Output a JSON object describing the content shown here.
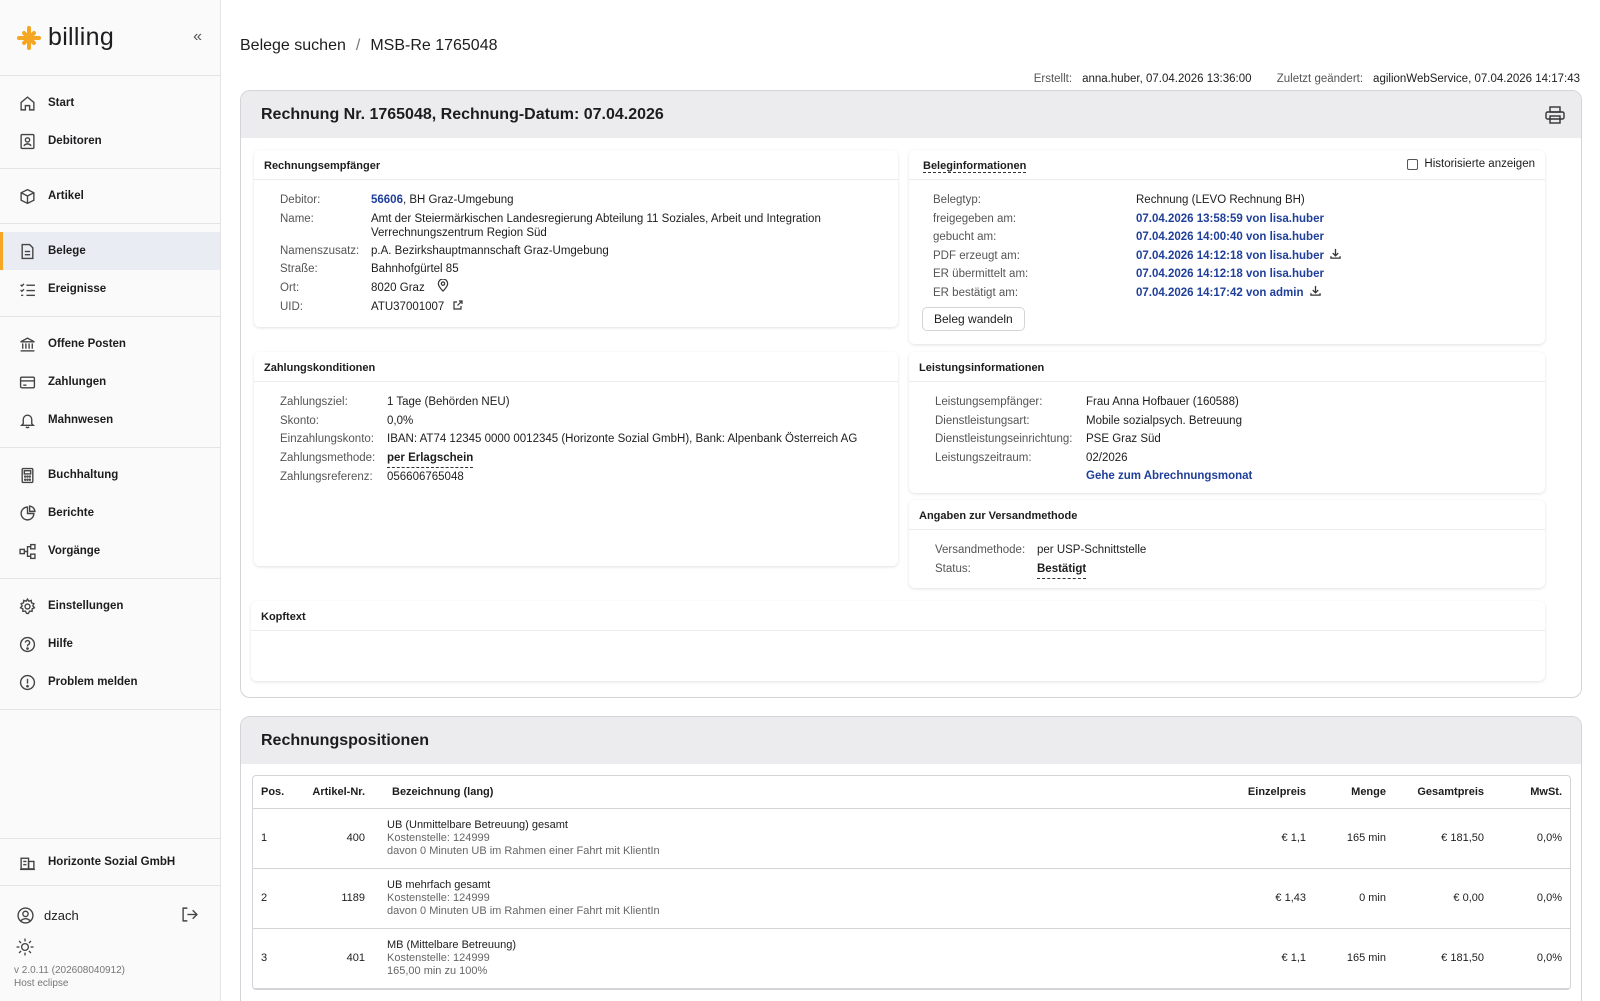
{
  "app": {
    "name": "billing"
  },
  "sidebar": {
    "groups": [
      [
        {
          "label": "Start",
          "icon": "home-icon"
        },
        {
          "label": "Debitoren",
          "icon": "contacts-icon"
        }
      ],
      [
        {
          "label": "Artikel",
          "icon": "box-icon"
        }
      ],
      [
        {
          "label": "Belege",
          "icon": "document-icon",
          "active": true
        },
        {
          "label": "Ereignisse",
          "icon": "checklist-icon"
        }
      ],
      [
        {
          "label": "Offene Posten",
          "icon": "bank-icon"
        },
        {
          "label": "Zahlungen",
          "icon": "card-icon"
        },
        {
          "label": "Mahnwesen",
          "icon": "bell-icon"
        }
      ],
      [
        {
          "label": "Buchhaltung",
          "icon": "calculator-icon"
        },
        {
          "label": "Berichte",
          "icon": "pie-chart-icon"
        },
        {
          "label": "Vorgänge",
          "icon": "workflow-icon"
        }
      ],
      [
        {
          "label": "Einstellungen",
          "icon": "gear-icon"
        },
        {
          "label": "Hilfe",
          "icon": "help-icon"
        },
        {
          "label": "Problem melden",
          "icon": "alert-icon"
        }
      ]
    ],
    "company": "Horizonte Sozial GmbH",
    "user": "dzach",
    "version_line1": "v 2.0.11 (202608040912)",
    "version_line2": "Host eclipse"
  },
  "breadcrumb": {
    "parent": "Belege suchen",
    "separator": "/",
    "current": "MSB-Re 1765048"
  },
  "meta": {
    "created_label": "Erstellt:",
    "created_value": "anna.huber, 07.04.2026 13:36:00",
    "modified_label": "Zuletzt geändert:",
    "modified_value": "agilionWebService, 07.04.2026 14:17:43"
  },
  "invoice": {
    "title": "Rechnung Nr. 1765048, Rechnung-Datum: 07.04.2026",
    "recipient": {
      "title": "Rechnungsempfänger",
      "debitor_label": "Debitor:",
      "debitor_id": "56606",
      "debitor_name": ", BH Graz-Umgebung",
      "name_label": "Name:",
      "name_line1": "Amt der Steiermärkischen Landesregierung Abteilung 11 Soziales, Arbeit und Integration",
      "name_line2": "Verrechnungszentrum Region Süd",
      "suffix_label": "Namenszusatz:",
      "suffix_value": "p.A. Bezirkshauptmannschaft Graz-Umgebung",
      "street_label": "Straße:",
      "street_value": "Bahnhofgürtel 85",
      "city_label": "Ort:",
      "city_value": "8020 Graz",
      "uid_label": "UID:",
      "uid_value": "ATU37001007"
    },
    "beleginfo": {
      "title": "Beleginformationen",
      "history_label": "Historisierte anzeigen",
      "rows": [
        {
          "k": "Belegtyp:",
          "v": "Rechnung (LEVO Rechnung BH)",
          "link": false,
          "download": false
        },
        {
          "k": "freigegeben am:",
          "v": "07.04.2026 13:58:59 von lisa.huber",
          "link": true,
          "download": false
        },
        {
          "k": "gebucht am:",
          "v": "07.04.2026 14:00:40 von lisa.huber",
          "link": true,
          "download": false
        },
        {
          "k": "PDF erzeugt am:",
          "v": "07.04.2026 14:12:18 von lisa.huber",
          "link": true,
          "download": true
        },
        {
          "k": "ER übermittelt am:",
          "v": "07.04.2026 14:12:18 von lisa.huber",
          "link": true,
          "download": false
        },
        {
          "k": "ER bestätigt am:",
          "v": "07.04.2026 14:17:42 von admin",
          "link": true,
          "download": true
        }
      ],
      "button": "Beleg wandeln"
    },
    "payment": {
      "title": "Zahlungskonditionen",
      "rows": [
        {
          "k": "Zahlungsziel:",
          "v": "1 Tage (Behörden NEU)"
        },
        {
          "k": "Skonto:",
          "v": "0,0%"
        },
        {
          "k": "Einzahlungskonto:",
          "v": "IBAN: AT74 12345 0000 0012345 (Horizonte Sozial GmbH), Bank: Alpenbank Österreich AG"
        },
        {
          "k": "Zahlungsmethode:",
          "v": "per Erlagschein"
        },
        {
          "k": "Zahlungsreferenz:",
          "v": "056606765048"
        }
      ]
    },
    "service": {
      "title": "Leistungsinformationen",
      "rows": [
        {
          "k": "Leistungsempfänger:",
          "v": "Frau Anna Hofbauer (160588)"
        },
        {
          "k": "Dienstleistungsart:",
          "v": "Mobile sozialpsych. Betreuung"
        },
        {
          "k": "Dienstleistungseinrichtung:",
          "v": "PSE Graz Süd"
        },
        {
          "k": "Leistungszeitraum:",
          "v": "02/2026"
        }
      ],
      "link": "Gehe zum Abrechnungsmonat"
    },
    "shipping": {
      "title": "Angaben zur Versandmethode",
      "method_label": "Versandmethode:",
      "method_value": "per USP-Schnittstelle",
      "status_label": "Status:",
      "status_value": "Bestätigt"
    },
    "kopftext": {
      "title": "Kopftext"
    }
  },
  "positions": {
    "title": "Rechnungspositionen",
    "columns": [
      "Pos.",
      "Artikel-Nr.",
      "Bezeichnung (lang)",
      "Einzelpreis",
      "Menge",
      "Gesamtpreis",
      "MwSt."
    ],
    "rows": [
      {
        "pos": "1",
        "art": "400",
        "name": "UB (Unmittelbare Betreuung) gesamt",
        "sub1": "Kostenstelle: 124999",
        "sub2": "davon 0 Minuten UB im Rahmen einer Fahrt mit KlientIn",
        "price": "€ 1,1",
        "qty": "165 min",
        "total": "€ 181,50",
        "vat": "0,0%"
      },
      {
        "pos": "2",
        "art": "1189",
        "name": "UB mehrfach gesamt",
        "sub1": "Kostenstelle: 124999",
        "sub2": "davon 0 Minuten UB im Rahmen einer Fahrt mit KlientIn",
        "price": "€ 1,43",
        "qty": "0 min",
        "total": "€ 0,00",
        "vat": "0,0%"
      },
      {
        "pos": "3",
        "art": "401",
        "name": "MB (Mittelbare Betreuung)",
        "sub1": "Kostenstelle: 124999",
        "sub2": "165,00 min zu 100%",
        "price": "€ 1,1",
        "qty": "165 min",
        "total": "€ 181,50",
        "vat": "0,0%"
      }
    ]
  }
}
